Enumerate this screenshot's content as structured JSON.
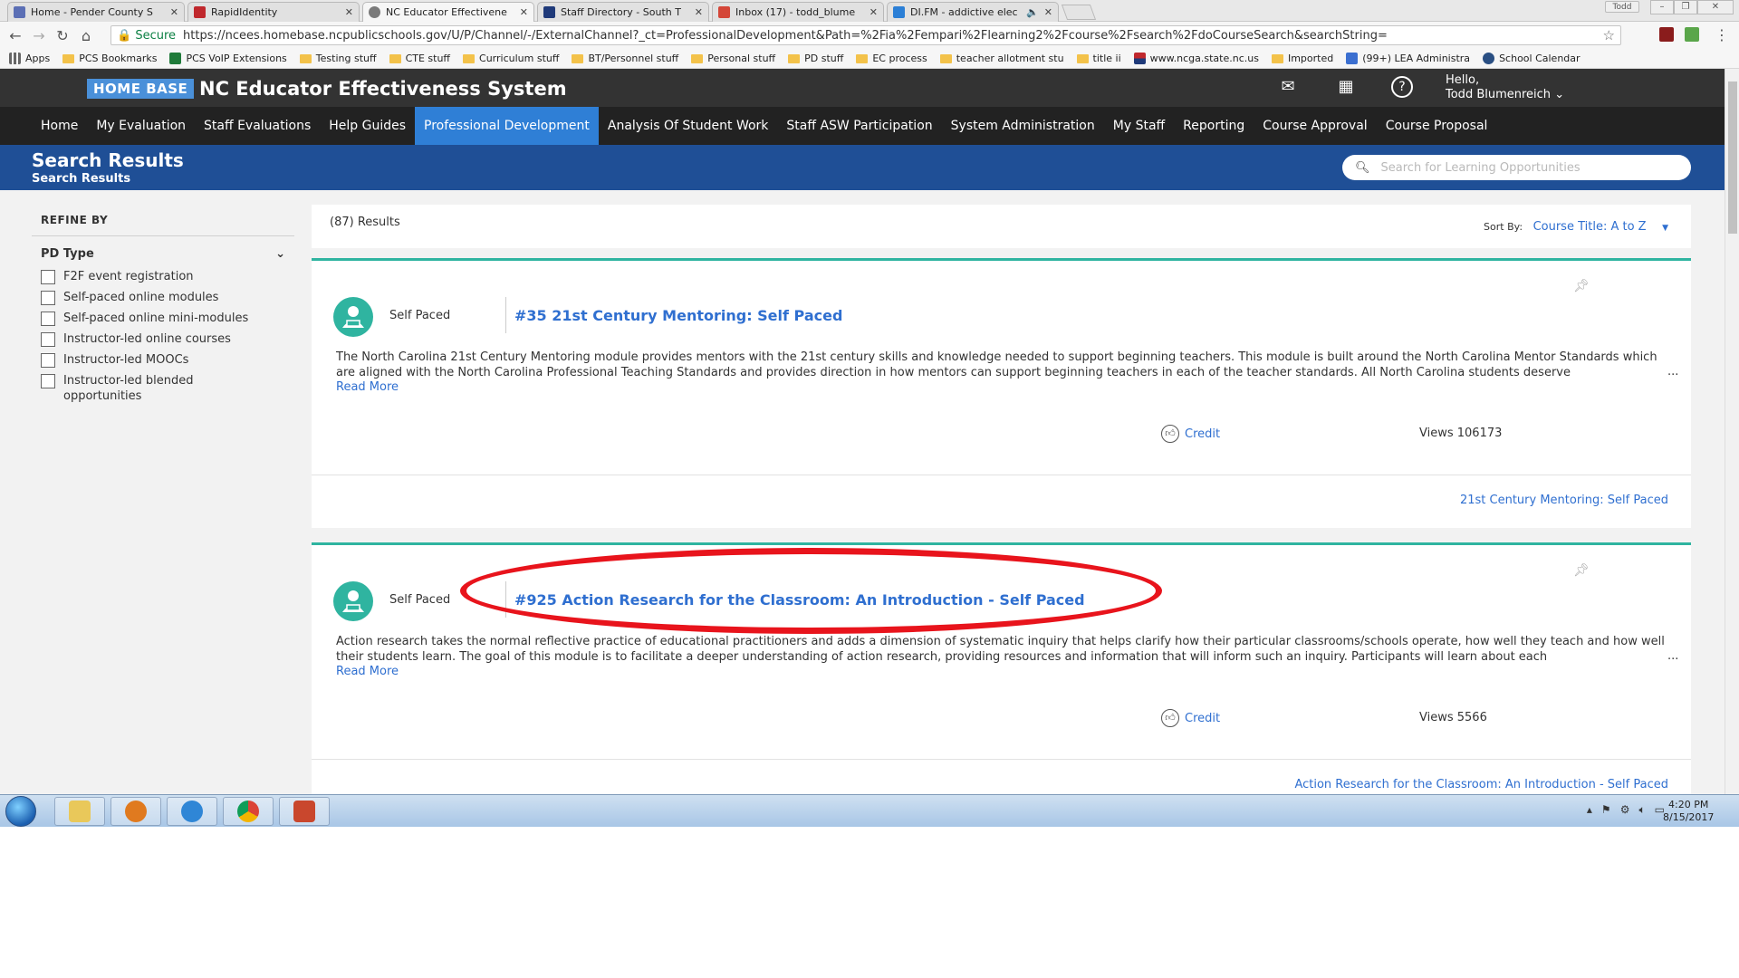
{
  "browser": {
    "tabs": [
      {
        "title": "Home - Pender County S",
        "color": "#5b6fb5"
      },
      {
        "title": "RapidIdentity",
        "color": "#c0282d"
      },
      {
        "title": "NC Educator Effectivene",
        "color": "#7a7a7a",
        "active": true
      },
      {
        "title": "Staff Directory - South T",
        "color": "#1f3a7a"
      },
      {
        "title": "Inbox (17) - todd_blume",
        "color": "#d44638"
      },
      {
        "title": "DI.FM - addictive elec",
        "color": "#2b7fd6"
      }
    ],
    "window_user": "Todd",
    "secure_label": "Secure",
    "url": "https://ncees.homebase.ncpublicschools.gov/U/P/Channel/-/ExternalChannel?_ct=ProfessionalDevelopment&Path=%2Fia%2Fempari%2Flearning2%2Fcourse%2Fsearch%2FdoCourseSearch&searchString=",
    "bookmarks": [
      {
        "label": "Apps",
        "icon": "apps-icon"
      },
      {
        "label": "PCS Bookmarks",
        "icon": "folder-icon"
      },
      {
        "label": "PCS VoIP Extensions",
        "icon": "sheet-icon"
      },
      {
        "label": "Testing stuff",
        "icon": "folder-icon"
      },
      {
        "label": "CTE stuff",
        "icon": "folder-icon"
      },
      {
        "label": "Curriculum stuff",
        "icon": "folder-icon"
      },
      {
        "label": "BT/Personnel stuff",
        "icon": "folder-icon"
      },
      {
        "label": "Personal stuff",
        "icon": "folder-icon"
      },
      {
        "label": "PD stuff",
        "icon": "folder-icon"
      },
      {
        "label": "EC process",
        "icon": "folder-icon"
      },
      {
        "label": "teacher allotment stu",
        "icon": "folder-icon"
      },
      {
        "label": "title ii",
        "icon": "folder-icon"
      },
      {
        "label": "www.ncga.state.nc.us",
        "icon": "flag-icon"
      },
      {
        "label": "Imported",
        "icon": "folder-icon"
      },
      {
        "label": "(99+) LEA Administra",
        "icon": "chat-icon"
      },
      {
        "label": "School Calendar",
        "icon": "globe-icon"
      }
    ]
  },
  "site": {
    "logo_text": "HOME BASE",
    "system_title": "NC Educator Effectiveness System",
    "greeting": "Hello,",
    "user_name": "Todd Blumenreich",
    "nav": [
      "Home",
      "My Evaluation",
      "Staff Evaluations",
      "Help Guides",
      "Professional Development",
      "Analysis Of Student Work",
      "Staff ASW Participation",
      "System Administration",
      "My Staff",
      "Reporting",
      "Course Approval",
      "Course Proposal"
    ],
    "active_nav": "Professional Development",
    "page_title": "Search Results",
    "breadcrumb": "Search Results",
    "search_placeholder": "Search for Learning Opportunities"
  },
  "filters": {
    "heading": "REFINE BY",
    "group": "PD Type",
    "options": [
      "F2F event registration",
      "Self-paced online modules",
      "Self-paced online mini-modules",
      "Instructor-led online courses",
      "Instructor-led MOOCs",
      "Instructor-led blended opportunities"
    ]
  },
  "results": {
    "count": "(87) Results",
    "sort_label": "Sort By:",
    "sort_value": "Course Title: A to Z",
    "items": [
      {
        "type": "Self Paced",
        "title": "#35 21st Century Mentoring: Self Paced",
        "description": "The North Carolina 21st Century Mentoring module provides mentors with the 21st century skills and knowledge needed to support beginning teachers. This module is built around the North Carolina Mentor Standards which are aligned with the North Carolina Professional Teaching Standards and provides direction in how mentors can support beginning teachers in each of the teacher standards. All North Carolina students deserve",
        "read_more": "Read More",
        "credit": "Credit",
        "views": "Views 106173",
        "footer": "21st Century Mentoring: Self Paced"
      },
      {
        "type": "Self Paced",
        "title": "#925 Action Research for the Classroom: An Introduction - Self Paced",
        "description": "Action research takes the normal reflective practice of educational practitioners and adds a dimension of systematic inquiry that helps clarify how their particular classrooms/schools operate, how well they teach and how well their students learn. The goal of this module is to facilitate a deeper understanding of action research, providing resources and information that will inform such an inquiry. Participants will learn about each",
        "read_more": "Read More",
        "credit": "Credit",
        "views": "Views 5566",
        "footer": "Action Research for the Classroom: An Introduction - Self Paced"
      }
    ],
    "ellipsis": "..."
  },
  "taskbar": {
    "time": "4:20 PM",
    "date": "8/15/2017"
  },
  "colors": {
    "accent": "#2f7fd6",
    "teal": "#2fb4a0",
    "annotation": "#e8141c"
  }
}
